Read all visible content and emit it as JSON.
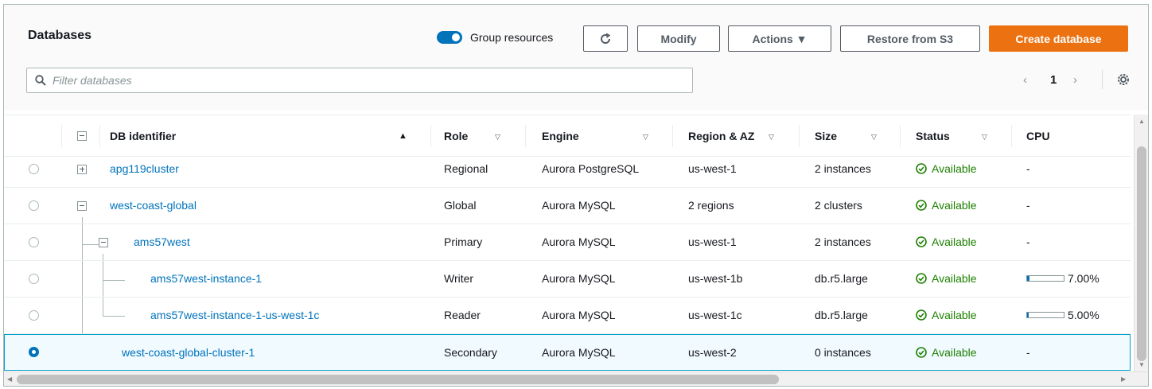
{
  "header": {
    "title": "Databases",
    "group_toggle_label": "Group resources",
    "group_toggle_on": true,
    "buttons": {
      "modify": "Modify",
      "actions": "Actions ▼",
      "restore": "Restore from S3",
      "create": "Create database"
    },
    "search_placeholder": "Filter databases",
    "pager": {
      "prev": "‹",
      "page": "1",
      "next": "›"
    }
  },
  "table": {
    "columns": {
      "identifier": "DB identifier",
      "role": "Role",
      "engine": "Engine",
      "region": "Region & AZ",
      "size": "Size",
      "status": "Status",
      "cpu": "CPU"
    },
    "rows": [
      {
        "id": "apg119cluster",
        "role": "Regional",
        "engine": "Aurora PostgreSQL",
        "region": "us-west-1",
        "size": "2 instances",
        "status": "Available",
        "cpu": "-",
        "selected": false
      },
      {
        "id": "west-coast-global",
        "role": "Global",
        "engine": "Aurora MySQL",
        "region": "2 regions",
        "size": "2 clusters",
        "status": "Available",
        "cpu": "-",
        "selected": false
      },
      {
        "id": "ams57west",
        "role": "Primary",
        "engine": "Aurora MySQL",
        "region": "us-west-1",
        "size": "2 instances",
        "status": "Available",
        "cpu": "-",
        "selected": false
      },
      {
        "id": "ams57west-instance-1",
        "role": "Writer",
        "engine": "Aurora MySQL",
        "region": "us-west-1b",
        "size": "db.r5.large",
        "status": "Available",
        "cpu": "7.00%",
        "cpu_value": 7,
        "selected": false
      },
      {
        "id": "ams57west-instance-1-us-west-1c",
        "role": "Reader",
        "engine": "Aurora MySQL",
        "region": "us-west-1c",
        "size": "db.r5.large",
        "status": "Available",
        "cpu": "5.00%",
        "cpu_value": 5,
        "selected": false
      },
      {
        "id": "west-coast-global-cluster-1",
        "role": "Secondary",
        "engine": "Aurora MySQL",
        "region": "us-west-2",
        "size": "0 instances",
        "status": "Available",
        "cpu": "-",
        "selected": true
      }
    ]
  },
  "colors": {
    "accent": "#0073bb",
    "primary_button": "#ec7211",
    "status_ok": "#1d8102"
  }
}
